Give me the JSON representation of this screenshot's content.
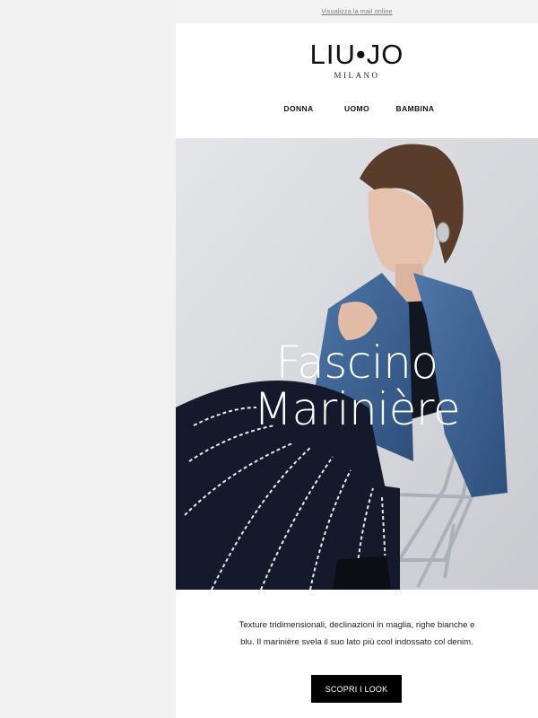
{
  "topbar": {
    "view_online": "Visualizza la mail online"
  },
  "brand": {
    "name": "LIU•JO",
    "city": "MILANO"
  },
  "nav": {
    "items": [
      "DONNA",
      "UOMO",
      "BAMBINA"
    ]
  },
  "hero": {
    "title_line1": "Fascino",
    "title_line2": "Marinière"
  },
  "body": {
    "line1": "Texture tridimensionali, declinazioni in maglia, righe bianche e",
    "line2": "blu. Il marinière svela il suo lato più cool indossato col denim."
  },
  "cta": {
    "label": "SCOPRI I LOOK"
  },
  "colors": {
    "cta_bg": "#000000",
    "background": "#f1f1f1",
    "hero_bg": "#d9dade"
  }
}
